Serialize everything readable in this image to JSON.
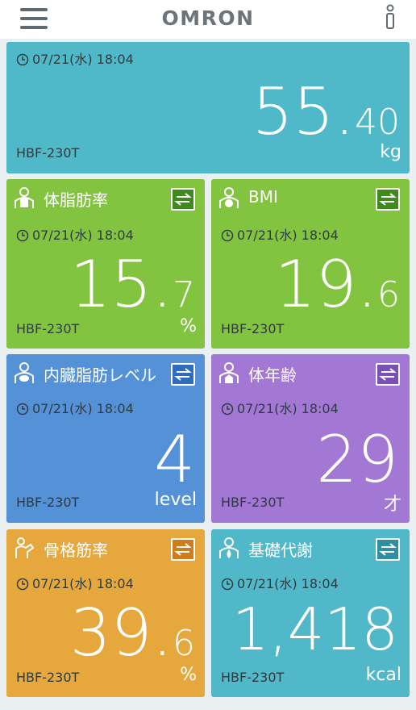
{
  "header": {
    "brand": "OMRON"
  },
  "cards": [
    {
      "id": "weight",
      "time": "07/21(水) 18:04",
      "int": "55",
      "dec": "40",
      "unit": "kg",
      "device": "HBF-230T",
      "color": "#4fb9c9"
    },
    {
      "id": "body-fat",
      "title": "体脂肪率",
      "time": "07/21(水) 18:04",
      "int": "15",
      "dec": "7",
      "unit": "%",
      "device": "HBF-230T",
      "color": "#82c43f",
      "swap_color": "#3e8a1f"
    },
    {
      "id": "bmi",
      "title": "BMI",
      "time": "07/21(水) 18:04",
      "int": "19",
      "dec": "6",
      "unit": "",
      "device": "HBF-230T",
      "color": "#82c43f",
      "swap_color": "#3e8a1f"
    },
    {
      "id": "visceral-fat",
      "title": "内臓脂肪レベル",
      "time": "07/21(水) 18:04",
      "int": "4",
      "dec": "",
      "unit": "level",
      "device": "HBF-230T",
      "color": "#5491d6",
      "swap_color": "#2f6cbf"
    },
    {
      "id": "body-age",
      "title": "体年齢",
      "time": "07/21(水) 18:04",
      "int": "29",
      "dec": "",
      "unit": "才",
      "device": "HBF-230T",
      "color": "#a377d4",
      "swap_color": "#7b4fb6"
    },
    {
      "id": "skeletal-muscle",
      "title": "骨格筋率",
      "time": "07/21(水) 18:04",
      "int": "39",
      "dec": "6",
      "unit": "%",
      "device": "HBF-230T",
      "color": "#e6a83c",
      "swap_color": "#cf7c1a"
    },
    {
      "id": "basal-metabolism",
      "title": "基礎代謝",
      "time": "07/21(水) 18:04",
      "int": "1,418",
      "dec": "",
      "unit": "kcal",
      "device": "HBF-230T",
      "color": "#51b8c9",
      "swap_color": "#2f8ea3"
    }
  ]
}
